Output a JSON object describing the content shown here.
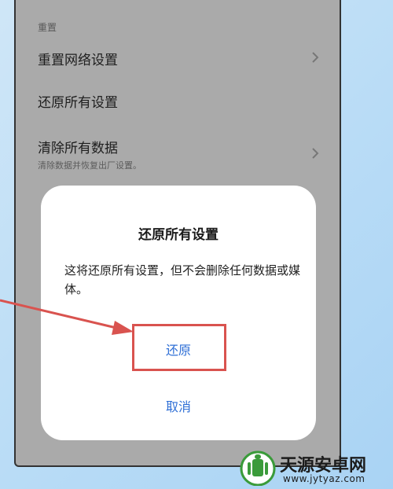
{
  "settings": {
    "section_header": "重置",
    "items": [
      {
        "title": "重置网络设置",
        "subtitle": "",
        "has_chevron": true
      },
      {
        "title": "还原所有设置",
        "subtitle": "",
        "has_chevron": false
      },
      {
        "title": "清除所有数据",
        "subtitle": "清除数据并恢复出厂设置。",
        "has_chevron": true
      }
    ]
  },
  "dialog": {
    "title": "还原所有设置",
    "message": "这将还原所有设置，但不会删除任何数据或媒体。",
    "confirm_label": "还原",
    "cancel_label": "取消"
  },
  "watermark": {
    "title": "天源安卓网",
    "url": "www.jytyaz.com"
  },
  "colors": {
    "background": "#b9dcf6",
    "dim_surface": "#aeaeae",
    "dialog": "#ffffff",
    "accent": "#2f6fd6",
    "annotation": "#d9534f"
  }
}
